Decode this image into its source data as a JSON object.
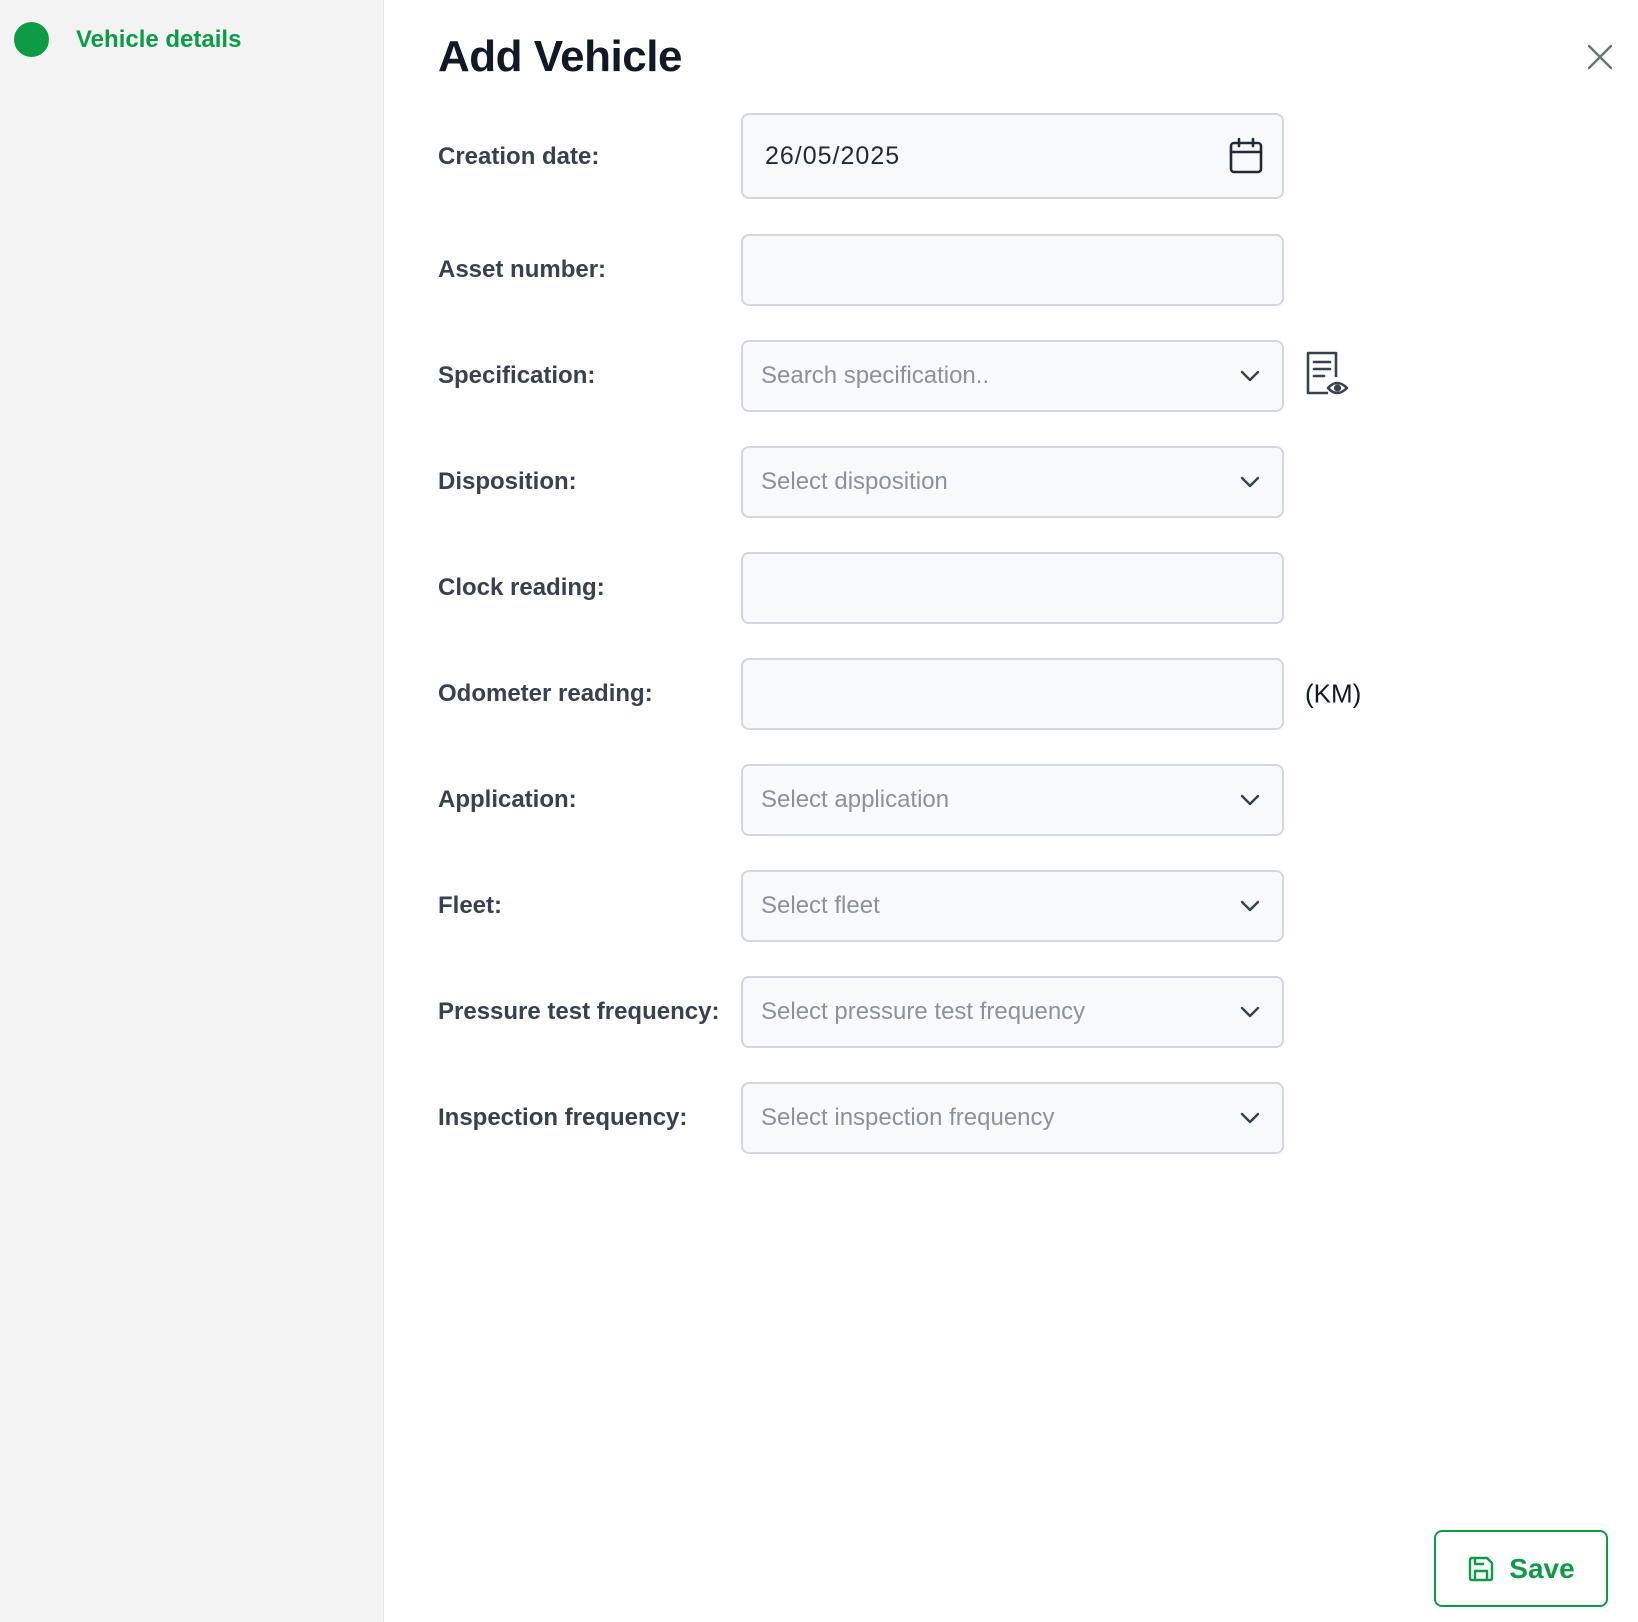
{
  "sidebar": {
    "steps": [
      {
        "label": "Vehicle details",
        "status_color": "#0d9c46"
      }
    ]
  },
  "dialog": {
    "title": "Add Vehicle",
    "close_icon": "close-icon"
  },
  "form": {
    "creation_date": {
      "label": "Creation date:",
      "value": "26/05/2025",
      "icon": "calendar-icon"
    },
    "asset_number": {
      "label": "Asset number:",
      "value": ""
    },
    "specification": {
      "label": "Specification:",
      "placeholder": "Search specification..",
      "view_icon": "document-view-icon"
    },
    "disposition": {
      "label": "Disposition:",
      "placeholder": "Select disposition"
    },
    "clock_reading": {
      "label": "Clock reading:",
      "value": ""
    },
    "odometer_reading": {
      "label": "Odometer reading:",
      "value": "",
      "unit": "(KM)"
    },
    "application": {
      "label": "Application:",
      "placeholder": "Select application"
    },
    "fleet": {
      "label": "Fleet:",
      "placeholder": "Select fleet"
    },
    "pressure_test_frequency": {
      "label": "Pressure test frequency:",
      "placeholder": "Select pressure test frequency"
    },
    "inspection_frequency": {
      "label": "Inspection frequency:",
      "placeholder": "Select inspection frequency"
    }
  },
  "actions": {
    "save_label": "Save",
    "save_icon": "floppy-disk-icon"
  },
  "colors": {
    "accent": "#0d9c46",
    "sidebar_bg": "#f3f3f3",
    "field_bg": "#f8f9fb",
    "field_border": "#d3d7de"
  }
}
